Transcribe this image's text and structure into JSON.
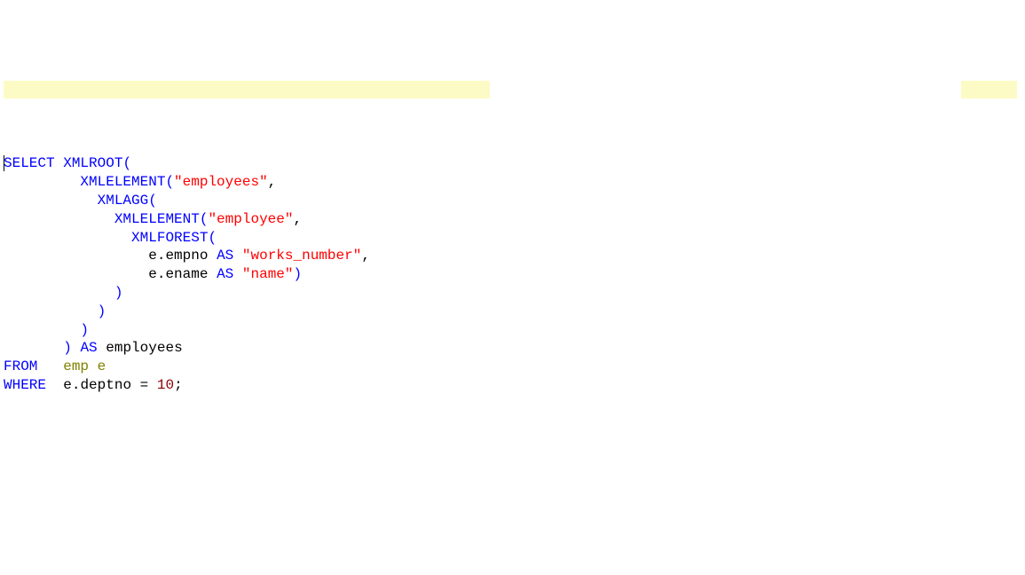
{
  "code": {
    "select": "SELECT",
    "xmlroot": "XMLROOT",
    "lparen1": "(",
    "xmlelement1": "XMLELEMENT",
    "lparen2": "(",
    "str_employees": "\"employees\"",
    "comma1": ",",
    "xmlagg": "XMLAGG",
    "lparen3": "(",
    "xmlelement2": "XMLELEMENT",
    "lparen4": "(",
    "str_employee": "\"employee\"",
    "comma2": ",",
    "xmlforest": "XMLFOREST",
    "lparen5": "(",
    "e1": "e",
    "dot1": ".",
    "empno": "empno",
    "as1": "AS",
    "str_works_number": "\"works_number\"",
    "comma3": ",",
    "e2": "e",
    "dot2": ".",
    "ename": "ename",
    "as2": "AS",
    "str_name": "\"name\"",
    "rparen1": ")",
    "rparen2": ")",
    "rparen3": ")",
    "rparen4": ")",
    "rparen5": ")",
    "as3": "AS",
    "employees_alias": "employees",
    "from": "FROM",
    "emp": "emp",
    "e_alias": "e",
    "where": "WHERE",
    "e3": "e",
    "dot3": ".",
    "deptno": "deptno",
    "eq": "=",
    "ten": "10",
    "semi": ";"
  }
}
